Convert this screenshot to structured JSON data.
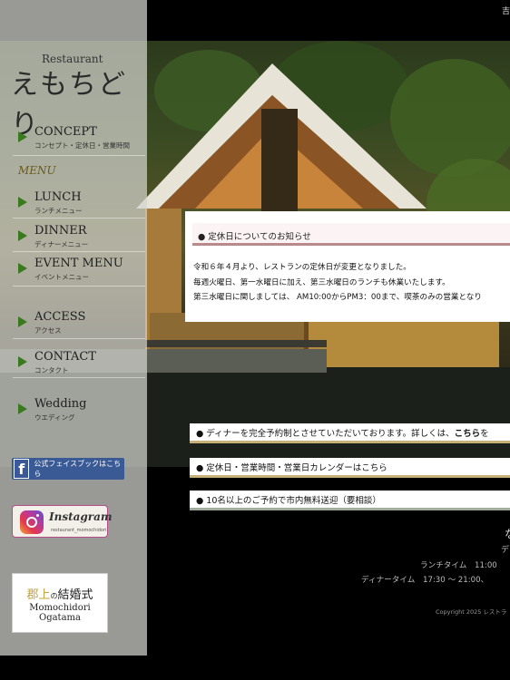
{
  "top_right_text": "吉",
  "sidebar": {
    "logo_small": "Restaurant",
    "logo_main": "えもちどり",
    "menu_heading": "MENU",
    "nav": [
      {
        "en": "CONCEPT",
        "jp": "コンセプト・定休日・営業時間"
      },
      {
        "en": "LUNCH",
        "jp": "ランチメニュー"
      },
      {
        "en": "DINNER",
        "jp": "ディナーメニュー"
      },
      {
        "en": "EVENT MENU",
        "jp": "イベントメニュー"
      },
      {
        "en": "ACCESS",
        "jp": "アクセス"
      },
      {
        "en": "CONTACT",
        "jp": "コンタクト"
      },
      {
        "en": "Wedding",
        "jp": "ウエディング"
      }
    ],
    "facebook_label": "公式フェイスブックはこちら",
    "instagram_title": "Instagram",
    "instagram_handle": "restaurant_momochidori",
    "wedding_line1_a": "郡上",
    "wedding_line1_b": "の",
    "wedding_line1_c": "結婚式",
    "wedding_line2": "Momochidori",
    "wedding_line3": "Ogatama"
  },
  "notice": {
    "heading": "● 定休日についてのお知らせ",
    "lines": [
      "令和６年４月より、レストランの定休日が変更となりました。",
      "毎週火曜日、第一水曜日に加え、第三水曜日のランチも休業いたします。",
      "第三水曜日に関しましては、 AM10:00からPM3：00まで、喫茶のみの営業となり"
    ]
  },
  "info_bars": {
    "dinner_prefix": "● ディナーを完全予約制とさせていただいております。詳しくは、",
    "dinner_link": "こちら",
    "dinner_suffix": "を",
    "holiday": "● 定休日・営業時間・営業日カレンダーはこちら",
    "shuttle": "● 10名以上のご予約で市内無料送迎（要相談）"
  },
  "footer": {
    "logo": "な",
    "sub": "デ",
    "lunch_time": "ランチタイム　11:00",
    "dinner_time": "ディナータイム　17:30 ～ 21:00、",
    "copyright": "Copyright 2025 レストラ"
  }
}
